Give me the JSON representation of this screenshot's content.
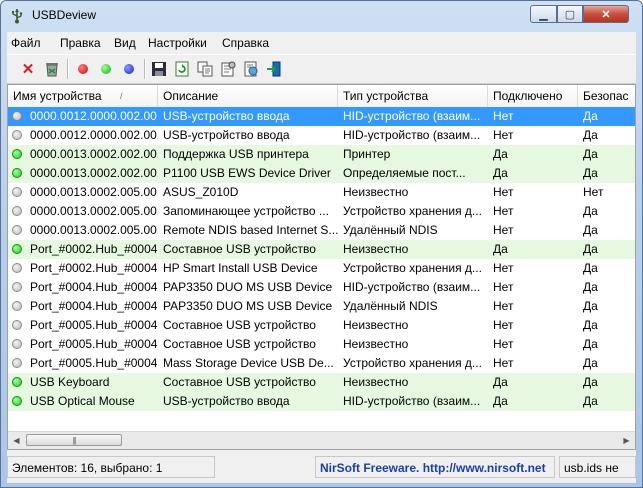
{
  "window": {
    "title": "USBDeview"
  },
  "menu": [
    "Файл",
    "Правка",
    "Вид",
    "Настройки",
    "Справка"
  ],
  "toolbar": {
    "buttons": [
      "disconnect-icon",
      "uninstall-icon",
      "red-dot-icon",
      "green-dot-icon",
      "blue-dot-icon",
      "save-icon",
      "refresh-icon",
      "copy-icon",
      "properties-icon",
      "html-report-icon",
      "exit-icon"
    ]
  },
  "colors": {
    "green_row": "#e6f8e0",
    "selected": "#3399ff",
    "connected_dot": "#22cc22",
    "disconnected_dot": "#b8b8b8"
  },
  "table": {
    "columns": [
      "Имя устройства",
      "Описание",
      "Тип устройства",
      "Подключено",
      "Безопас"
    ],
    "sort_indicator": "/",
    "rows": [
      {
        "name": "0000.0012.0000.002.00...",
        "desc": "USB-устройство ввода",
        "type": "HID-устройство (взаим...",
        "connected": "Нет",
        "safe": "Да",
        "state": "selected",
        "dot": "grey"
      },
      {
        "name": "0000.0012.0000.002.00...",
        "desc": "USB-устройство ввода",
        "type": "HID-устройство (взаим...",
        "connected": "Нет",
        "safe": "Да",
        "state": "normal",
        "dot": "grey"
      },
      {
        "name": "0000.0013.0002.002.00...",
        "desc": "Поддержка USB принтера",
        "type": "Принтер",
        "connected": "Да",
        "safe": "Да",
        "state": "green",
        "dot": "green"
      },
      {
        "name": "0000.0013.0002.002.00...",
        "desc": "P1100 USB EWS Device Driver",
        "type": "Определяемые пост...",
        "connected": "Да",
        "safe": "Да",
        "state": "green",
        "dot": "green"
      },
      {
        "name": "0000.0013.0002.005.00...",
        "desc": "ASUS_Z010D",
        "type": "Неизвестно",
        "connected": "Нет",
        "safe": "Нет",
        "state": "normal",
        "dot": "grey"
      },
      {
        "name": "0000.0013.0002.005.00...",
        "desc": "Запоминающее устройство ...",
        "type": "Устройство хранения д...",
        "connected": "Нет",
        "safe": "Да",
        "state": "normal",
        "dot": "grey"
      },
      {
        "name": "0000.0013.0002.005.00...",
        "desc": "Remote NDIS based Internet S...",
        "type": "Удалённый NDIS",
        "connected": "Нет",
        "safe": "Да",
        "state": "normal",
        "dot": "grey"
      },
      {
        "name": "Port_#0002.Hub_#0004",
        "desc": "Составное USB устройство",
        "type": "Неизвестно",
        "connected": "Да",
        "safe": "Да",
        "state": "green",
        "dot": "green"
      },
      {
        "name": "Port_#0002.Hub_#0004",
        "desc": "HP Smart Install USB Device",
        "type": "Устройство хранения д...",
        "connected": "Нет",
        "safe": "Да",
        "state": "normal",
        "dot": "grey"
      },
      {
        "name": "Port_#0004.Hub_#0004",
        "desc": "PAP3350 DUO MS USB Device",
        "type": "HID-устройство (взаим...",
        "connected": "Нет",
        "safe": "Да",
        "state": "normal",
        "dot": "grey"
      },
      {
        "name": "Port_#0004.Hub_#0004",
        "desc": "PAP3350 DUO MS USB Device",
        "type": "Удалённый NDIS",
        "connected": "Нет",
        "safe": "Да",
        "state": "normal",
        "dot": "grey"
      },
      {
        "name": "Port_#0005.Hub_#0004",
        "desc": "Составное USB устройство",
        "type": "Неизвестно",
        "connected": "Нет",
        "safe": "Да",
        "state": "normal",
        "dot": "grey"
      },
      {
        "name": "Port_#0005.Hub_#0004",
        "desc": "Составное USB устройство",
        "type": "Неизвестно",
        "connected": "Нет",
        "safe": "Да",
        "state": "normal",
        "dot": "grey"
      },
      {
        "name": "Port_#0005.Hub_#0004",
        "desc": "  Mass Storage Device USB De...",
        "type": "Устройство хранения д...",
        "connected": "Нет",
        "safe": "Да",
        "state": "normal",
        "dot": "grey"
      },
      {
        "name": "USB Keyboard",
        "desc": "Составное USB устройство",
        "type": "Неизвестно",
        "connected": "Да",
        "safe": "Да",
        "state": "green",
        "dot": "green"
      },
      {
        "name": "USB Optical Mouse",
        "desc": "USB-устройство ввода",
        "type": "HID-устройство (взаим...",
        "connected": "Да",
        "safe": "Да",
        "state": "green",
        "dot": "green"
      }
    ]
  },
  "statusbar": {
    "count": "Элементов: 16, выбрано: 1",
    "link": "NirSoft Freeware.  http://www.nirsoft.net",
    "ids": "usb.ids не"
  }
}
